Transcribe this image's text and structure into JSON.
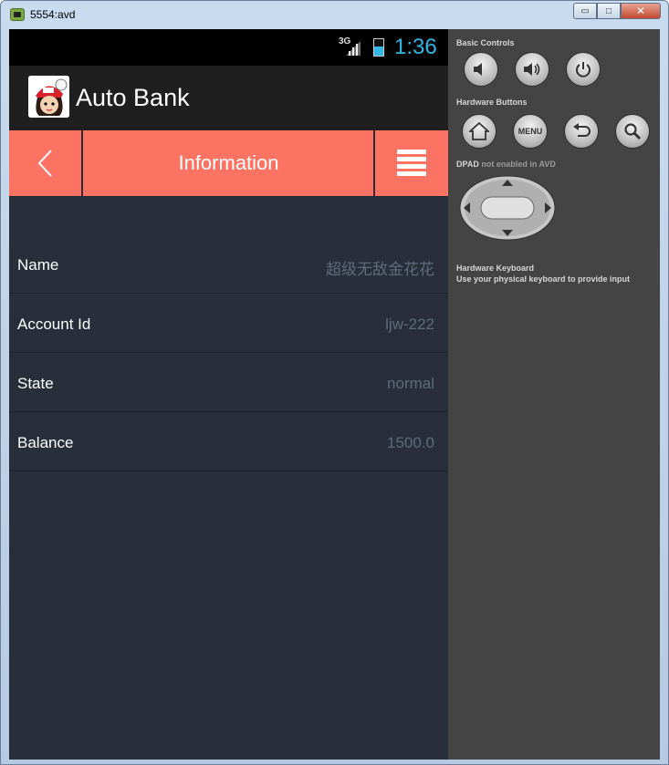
{
  "window": {
    "title": "5554:avd",
    "minimize_label": "▭",
    "maximize_label": "□",
    "close_label": "✕"
  },
  "statusbar": {
    "network": "3G",
    "time": "1:36"
  },
  "app": {
    "name": "Auto Bank"
  },
  "navbar": {
    "title": "Information"
  },
  "info_rows": [
    {
      "label": "Name",
      "value": "超级无敌金花花"
    },
    {
      "label": "Account Id",
      "value": "ljw-222"
    },
    {
      "label": "State",
      "value": "normal"
    },
    {
      "label": "Balance",
      "value": "1500.0"
    }
  ],
  "controls": {
    "basic_label": "Basic Controls",
    "hardware_label": "Hardware Buttons",
    "menu_button_label": "MENU",
    "dpad_label": "DPAD",
    "dpad_note": "not enabled in AVD",
    "keyboard_label": "Hardware Keyboard",
    "keyboard_hint": "Use your physical keyboard to provide input"
  },
  "colors": {
    "accent": "#fd7363",
    "screen_bg": "#282f3a",
    "clock": "#33b5e5",
    "panel_bg": "#444444"
  }
}
